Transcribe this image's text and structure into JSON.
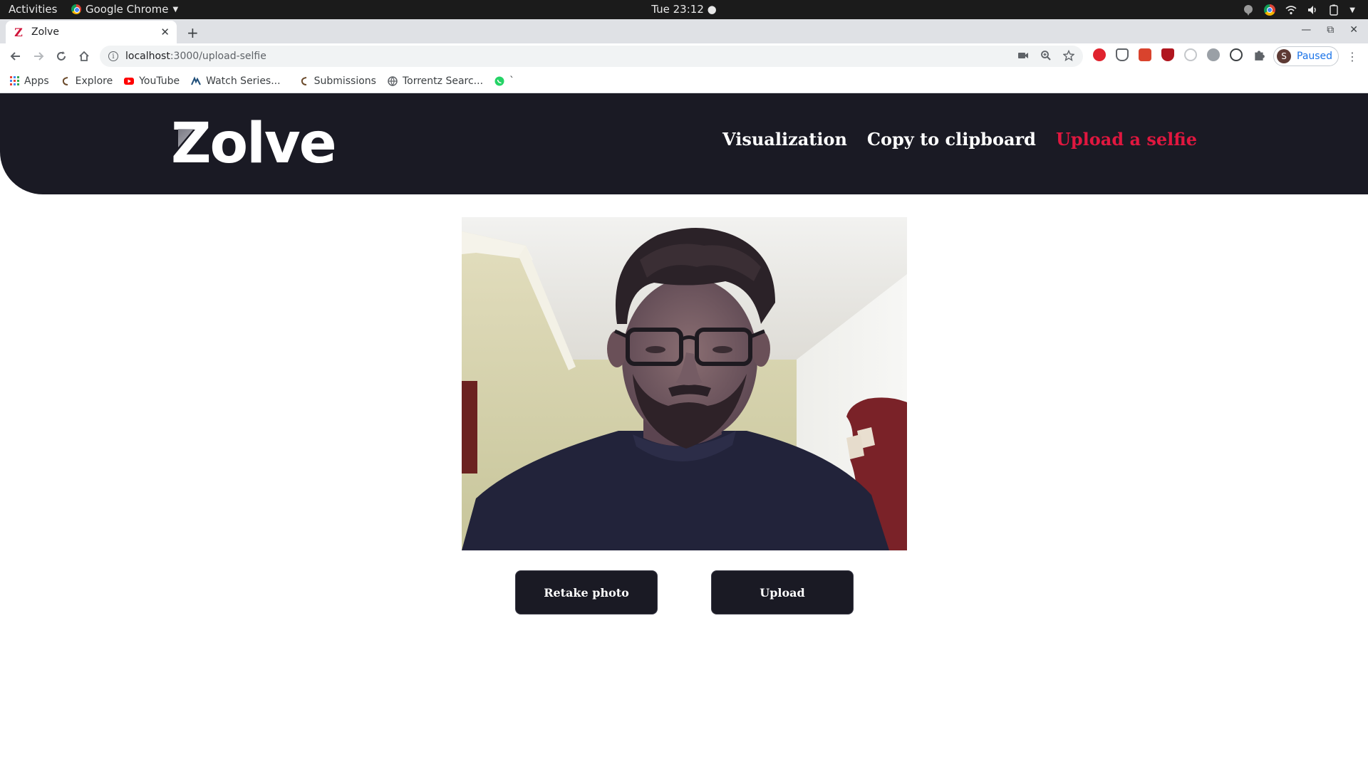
{
  "os": {
    "activities": "Activities",
    "app_name": "Google Chrome",
    "clock": "Tue 23:12 ●"
  },
  "browser": {
    "tab_title": "Zolve",
    "url_host": "localhost",
    "url_path": ":3000/upload-selfie",
    "profile_initial": "S",
    "profile_status": "Paused",
    "bookmarks": [
      {
        "label": "Apps"
      },
      {
        "label": "Explore"
      },
      {
        "label": "YouTube"
      },
      {
        "label": "Watch Series..."
      },
      {
        "label": "Submissions"
      },
      {
        "label": "Torrentz Searc..."
      },
      {
        "label": "`"
      }
    ]
  },
  "site": {
    "logo": "Zolve",
    "nav": [
      {
        "label": "Visualization"
      },
      {
        "label": "Copy to clipboard"
      },
      {
        "label": "Upload a selfie"
      }
    ],
    "buttons": {
      "retake": "Retake photo",
      "upload": "Upload"
    }
  },
  "colors": {
    "header_bg": "#1a1a24",
    "accent": "#e0173f",
    "button_bg": "#1a1a24"
  }
}
